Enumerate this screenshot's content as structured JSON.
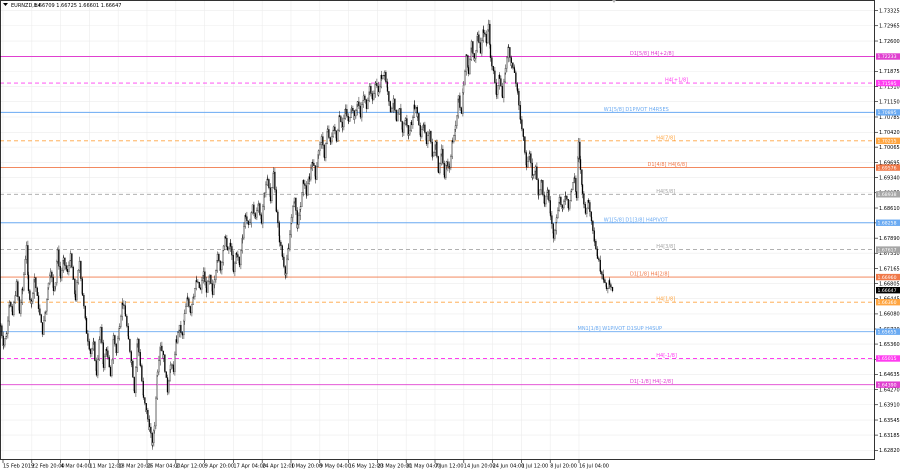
{
  "chart_data": {
    "type": "candlestick",
    "title": {
      "symbol": "EURNZD,H4",
      "ohlc": "1.66709 1.66725 1.66601 1.66647"
    },
    "ylim": [
      1.6259,
      1.7358
    ],
    "y_ticks": [
      "1.73325",
      "1.72965",
      "1.72600",
      "1.71875",
      "1.71510",
      "1.71150",
      "1.70785",
      "1.70420",
      "1.70065",
      "1.69695",
      "1.69340",
      "1.68975",
      "1.68610",
      "1.68255",
      "1.67890",
      "1.67530",
      "1.67165",
      "1.66805",
      "1.66445",
      "1.66080",
      "1.65720",
      "1.65360",
      "1.64995",
      "1.64635",
      "1.64270",
      "1.63910",
      "1.63545",
      "1.63185",
      "1.62820"
    ],
    "x_ticks": [
      "15 Feb 2019",
      "22 Feb 20:00",
      "4 Mar 04:00",
      "11 Mar 12:00",
      "18 Mar 20:00",
      "26 Mar 04:00",
      "2 Apr 12:00",
      "9 Apr 20:00",
      "17 Apr 04:00",
      "24 Apr 12:00",
      "1 May 20:00",
      "9 May 04:00",
      "16 May 12:00",
      "23 May 20:00",
      "31 May 04:00",
      "7 Jun 12:00",
      "14 Jun 20:00",
      "24 Jun 04:00",
      "1 Jul 12:00",
      "8 Jul 20:00",
      "16 Jul 04:00"
    ],
    "price_path": [
      [
        0,
        1.658
      ],
      [
        3,
        1.6535
      ],
      [
        6,
        1.656
      ],
      [
        9,
        1.664
      ],
      [
        12,
        1.6605
      ],
      [
        16,
        1.668
      ],
      [
        19,
        1.661
      ],
      [
        22,
        1.6665
      ],
      [
        26,
        1.6775
      ],
      [
        28,
        1.666
      ],
      [
        31,
        1.6635
      ],
      [
        34,
        1.6695
      ],
      [
        38,
        1.6625
      ],
      [
        42,
        1.6565
      ],
      [
        45,
        1.6615
      ],
      [
        48,
        1.668
      ],
      [
        50,
        1.6715
      ],
      [
        53,
        1.6665
      ],
      [
        55,
        1.6685
      ],
      [
        57,
        1.6755
      ],
      [
        60,
        1.6695
      ],
      [
        63,
        1.6735
      ],
      [
        67,
        1.6705
      ],
      [
        70,
        1.6745
      ],
      [
        73,
        1.6685
      ],
      [
        75,
        1.6645
      ],
      [
        79,
        1.6735
      ],
      [
        82,
        1.6655
      ],
      [
        86,
        1.6565
      ],
      [
        90,
        1.6515
      ],
      [
        93,
        1.6535
      ],
      [
        96,
        1.6465
      ],
      [
        100,
        1.6575
      ],
      [
        103,
        1.6485
      ],
      [
        106,
        1.6525
      ],
      [
        110,
        1.6455
      ],
      [
        113,
        1.6555
      ],
      [
        116,
        1.6515
      ],
      [
        119,
        1.6585
      ],
      [
        122,
        1.6635
      ],
      [
        125,
        1.6605
      ],
      [
        128,
        1.6545
      ],
      [
        131,
        1.6495
      ],
      [
        134,
        1.6425
      ],
      [
        137,
        1.6545
      ],
      [
        140,
        1.6485
      ],
      [
        143,
        1.6405
      ],
      [
        146,
        1.6375
      ],
      [
        149,
        1.6335
      ],
      [
        152,
        1.6295
      ],
      [
        154,
        1.6345
      ],
      [
        157,
        1.6475
      ],
      [
        160,
        1.6535
      ],
      [
        163,
        1.6505
      ],
      [
        167,
        1.6425
      ],
      [
        170,
        1.6485
      ],
      [
        173,
        1.6475
      ],
      [
        176,
        1.6545
      ],
      [
        179,
        1.6575
      ],
      [
        182,
        1.6555
      ],
      [
        184,
        1.6605
      ],
      [
        187,
        1.6645
      ],
      [
        190,
        1.6615
      ],
      [
        193,
        1.6655
      ],
      [
        196,
        1.6685
      ],
      [
        200,
        1.6665
      ],
      [
        203,
        1.6705
      ],
      [
        206,
        1.6665
      ],
      [
        209,
        1.6695
      ],
      [
        212,
        1.6655
      ],
      [
        214,
        1.6695
      ],
      [
        217,
        1.6745
      ],
      [
        220,
        1.6715
      ],
      [
        223,
        1.6765
      ],
      [
        225,
        1.6795
      ],
      [
        227,
        1.6755
      ],
      [
        230,
        1.6775
      ],
      [
        233,
        1.6705
      ],
      [
        236,
        1.6755
      ],
      [
        239,
        1.6725
      ],
      [
        242,
        1.6795
      ],
      [
        245,
        1.6845
      ],
      [
        248,
        1.6815
      ],
      [
        252,
        1.6865
      ],
      [
        255,
        1.6835
      ],
      [
        258,
        1.6875
      ],
      [
        261,
        1.6825
      ],
      [
        264,
        1.6895
      ],
      [
        267,
        1.6935
      ],
      [
        270,
        1.6885
      ],
      [
        273,
        1.6945
      ],
      [
        276,
        1.6855
      ],
      [
        279,
        1.6785
      ],
      [
        282,
        1.6745
      ],
      [
        285,
        1.6705
      ],
      [
        288,
        1.6765
      ],
      [
        291,
        1.6835
      ],
      [
        294,
        1.6885
      ],
      [
        297,
        1.6815
      ],
      [
        300,
        1.6865
      ],
      [
        303,
        1.6925
      ],
      [
        306,
        1.6895
      ],
      [
        309,
        1.6935
      ],
      [
        312,
        1.6975
      ],
      [
        315,
        1.6935
      ],
      [
        318,
        1.6995
      ],
      [
        321,
        1.7025
      ],
      [
        324,
        1.6985
      ],
      [
        327,
        1.7045
      ],
      [
        330,
        1.7015
      ],
      [
        333,
        1.7055
      ],
      [
        336,
        1.7025
      ],
      [
        339,
        1.7085
      ],
      [
        342,
        1.7055
      ],
      [
        345,
        1.7095
      ],
      [
        348,
        1.7065
      ],
      [
        351,
        1.7105
      ],
      [
        354,
        1.7075
      ],
      [
        357,
        1.7115
      ],
      [
        360,
        1.7085
      ],
      [
        363,
        1.7125
      ],
      [
        366,
        1.7105
      ],
      [
        369,
        1.7145
      ],
      [
        372,
        1.7115
      ],
      [
        375,
        1.7165
      ],
      [
        378,
        1.7135
      ],
      [
        381,
        1.7175
      ],
      [
        384,
        1.7185
      ],
      [
        387,
        1.7145
      ],
      [
        390,
        1.7095
      ],
      [
        393,
        1.7115
      ],
      [
        396,
        1.7065
      ],
      [
        399,
        1.7095
      ],
      [
        402,
        1.7045
      ],
      [
        405,
        1.7075
      ],
      [
        408,
        1.7035
      ],
      [
        411,
        1.7065
      ],
      [
        414,
        1.7105
      ],
      [
        417,
        1.7085
      ],
      [
        420,
        1.7035
      ],
      [
        423,
        1.7065
      ],
      [
        426,
        1.7015
      ],
      [
        429,
        1.7045
      ],
      [
        432,
        1.6985
      ],
      [
        435,
        1.7015
      ],
      [
        438,
        1.6945
      ],
      [
        441,
        1.6995
      ],
      [
        444,
        1.6935
      ],
      [
        446,
        1.6975
      ],
      [
        449,
        1.6955
      ],
      [
        452,
        1.7025
      ],
      [
        455,
        1.7055
      ],
      [
        458,
        1.7125
      ],
      [
        461,
        1.7085
      ],
      [
        463,
        1.7155
      ],
      [
        466,
        1.7225
      ],
      [
        468,
        1.7185
      ],
      [
        471,
        1.7255
      ],
      [
        474,
        1.7215
      ],
      [
        477,
        1.7275
      ],
      [
        480,
        1.7235
      ],
      [
        483,
        1.7285
      ],
      [
        486,
        1.7255
      ],
      [
        488,
        1.7305
      ],
      [
        490,
        1.7225
      ],
      [
        493,
        1.7185
      ],
      [
        496,
        1.7135
      ],
      [
        499,
        1.7175
      ],
      [
        502,
        1.7125
      ],
      [
        505,
        1.7195
      ],
      [
        508,
        1.7245
      ],
      [
        511,
        1.7205
      ],
      [
        514,
        1.7185
      ],
      [
        517,
        1.7135
      ],
      [
        520,
        1.7075
      ],
      [
        523,
        1.7025
      ],
      [
        526,
        1.6965
      ],
      [
        529,
        1.6985
      ],
      [
        532,
        1.6935
      ],
      [
        535,
        1.6955
      ],
      [
        538,
        1.6895
      ],
      [
        541,
        1.6925
      ],
      [
        544,
        1.6865
      ],
      [
        547,
        1.6905
      ],
      [
        550,
        1.6845
      ],
      [
        553,
        1.6795
      ],
      [
        556,
        1.6835
      ],
      [
        559,
        1.6885
      ],
      [
        562,
        1.6855
      ],
      [
        565,
        1.6895
      ],
      [
        568,
        1.6865
      ],
      [
        571,
        1.6905
      ],
      [
        574,
        1.6935
      ],
      [
        576,
        1.6885
      ],
      [
        578,
        1.7015
      ],
      [
        580,
        1.6955
      ],
      [
        582,
        1.6895
      ],
      [
        585,
        1.6855
      ],
      [
        588,
        1.6875
      ],
      [
        591,
        1.6835
      ],
      [
        594,
        1.6785
      ],
      [
        597,
        1.6745
      ],
      [
        600,
        1.6715
      ],
      [
        603,
        1.6695
      ],
      [
        606,
        1.6665
      ],
      [
        609,
        1.6685
      ],
      [
        612,
        1.6666
      ]
    ],
    "levels": [
      {
        "label": "D1[5/8] H4[+2/8]",
        "value": 1.7223,
        "tag": "1.72233",
        "color": "#e040d0",
        "dash": false,
        "label_pos": 0.72
      },
      {
        "label": "H4[+1/8]",
        "value": 1.71595,
        "tag": "1.71595",
        "color": "#ff3df0",
        "dash": true,
        "label_pos": 0.76
      },
      {
        "label": "W1[5/8] D1PIVOT H4R5ES",
        "value": 1.70895,
        "tag": "1.70895",
        "color": "#6aaaf2",
        "dash": false,
        "label_pos": 0.69
      },
      {
        "label": "H4[7/8]",
        "value": 1.70215,
        "tag": "1.70215",
        "color": "#ffa540",
        "dash": true,
        "label_pos": 0.75
      },
      {
        "label": "D1[4/8] H4[6/8]",
        "value": 1.69576,
        "tag": "1.69576",
        "color": "#f07848",
        "dash": false,
        "label_pos": 0.74
      },
      {
        "label": "H4[5/8]",
        "value": 1.68938,
        "tag": "1.68938",
        "color": "#a6a6a6",
        "dash": true,
        "label_pos": 0.75
      },
      {
        "label": "W1[5/8] D1[3/8] H4PIVOT",
        "value": 1.68258,
        "tag": "1.68258",
        "color": "#6aaaf2",
        "dash": false,
        "label_pos": 0.69
      },
      {
        "label": "H4[3/8]",
        "value": 1.67617,
        "tag": "1.67617",
        "color": "#a6a6a6",
        "dash": true,
        "label_pos": 0.75
      },
      {
        "label": "D1[1/8] H4[2/8]",
        "value": 1.6696,
        "tag": "1.66960",
        "color": "#f07848",
        "dash": false,
        "label_pos": 0.72
      },
      {
        "label": "H4[1/8]",
        "value": 1.6636,
        "tag": "1.66360",
        "color": "#ffa540",
        "dash": true,
        "label_pos": 0.75
      },
      {
        "label": "MN1[1/8] W1PIVOT D1SUP H4SUP",
        "value": 1.65655,
        "tag": "1.65655",
        "color": "#6aaaf2",
        "dash": false,
        "label_pos": 0.66
      },
      {
        "label": "H4[-1/8]",
        "value": 1.65015,
        "tag": "1.65015",
        "color": "#ff3df0",
        "dash": true,
        "label_pos": 0.75
      },
      {
        "label": "D1[-1/8] H4[-2/8]",
        "value": 1.6439,
        "tag": "1.64390",
        "color": "#e040d0",
        "dash": false,
        "label_pos": 0.72
      }
    ],
    "current_price": {
      "value": 1.66647,
      "tag": "1.66647",
      "color": "#000000"
    },
    "grid": true
  }
}
